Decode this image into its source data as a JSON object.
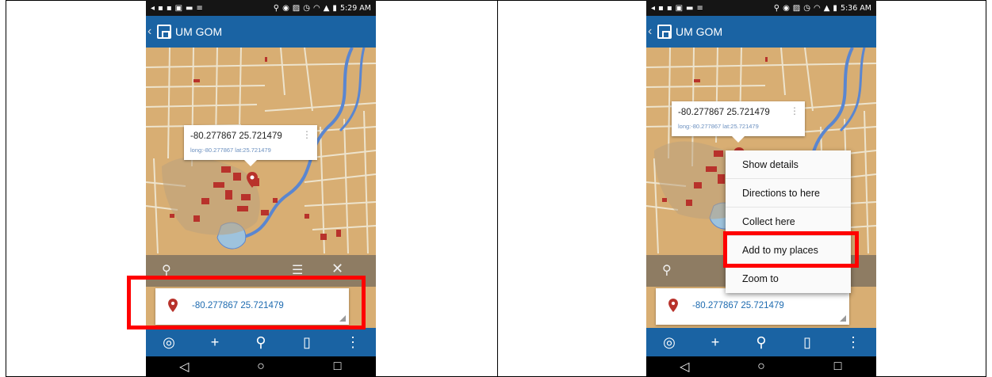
{
  "screens": [
    {
      "status_time": "5:29 AM",
      "app_title": "UM GOM",
      "popup": {
        "coords": "-80.277867 25.721479",
        "subtitle": "long:-80.277867 lat:25.721479"
      },
      "result": {
        "coords": "-80.277867 25.721479"
      }
    },
    {
      "status_time": "5:36 AM",
      "app_title": "UM GOM",
      "popup": {
        "coords": "-80.277867 25.721479",
        "subtitle": "long:-80.277867 lat:25.721479"
      },
      "result": {
        "coords": "-80.277867 25.721479"
      },
      "menu": [
        {
          "label": "Show details"
        },
        {
          "label": "Directions to here"
        },
        {
          "label": "Collect here"
        },
        {
          "label": "Add to my places"
        },
        {
          "label": "Zoom to"
        }
      ]
    }
  ],
  "icons": {
    "locate": "target-icon",
    "add": "plus-icon",
    "search": "search-icon",
    "map": "book-icon",
    "more": "more-vertical-icon",
    "back": "back-triangle-icon",
    "home": "home-circle-icon",
    "recent": "recent-square-icon"
  },
  "colors": {
    "app_bar": "#1a63a3",
    "map_base": "#d8ae73",
    "building": "#b8322b",
    "water": "#7fb0d8",
    "highlight": "#ff0000",
    "link_text": "#1e6bb0"
  }
}
